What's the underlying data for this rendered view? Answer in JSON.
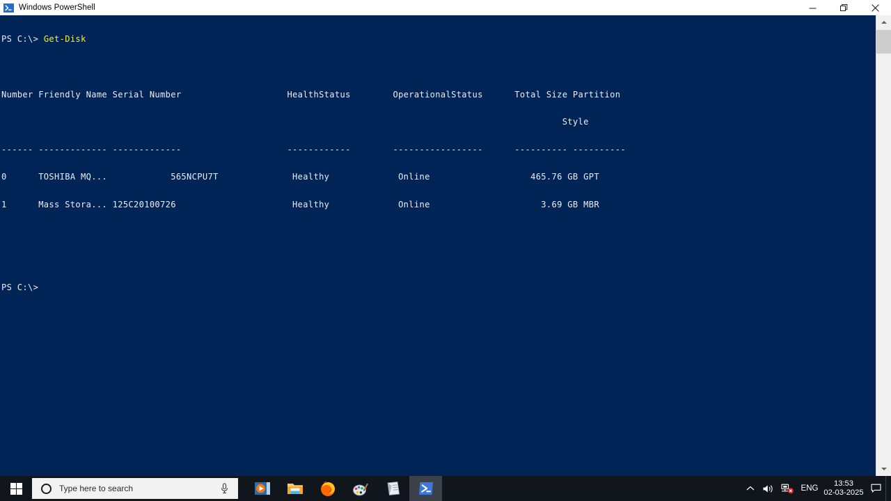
{
  "window": {
    "title": "Windows PowerShell",
    "icon": "powershell-icon",
    "controls": {
      "minimize": "minimize-button",
      "restore": "restore-button",
      "close": "close-button"
    }
  },
  "console": {
    "background_color": "#012456",
    "foreground_color": "#eeedf0",
    "accent_command_color": "#f3f32f",
    "prompt": "PS C:\\>",
    "command": "Get-Disk",
    "lines": [
      {
        "text": "Number Friendly Name Serial Number                    HealthStatus        OperationalStatus      Total Size Partition "
      },
      {
        "text": "                                                                                                          Style     "
      },
      {
        "text": "------ ------------- -------------                    ------------        -----------------      ---------- ----------"
      },
      {
        "text": "0      TOSHIBA MQ...            565NCPU7T              Healthy             Online                   465.76 GB GPT       "
      },
      {
        "text": "1      Mass Stora... 125C20100726                      Healthy             Online                     3.69 GB MBR       "
      }
    ],
    "trailing_prompt": "PS C:\\>"
  },
  "table": {
    "headers": [
      "Number",
      "Friendly Name",
      "Serial Number",
      "HealthStatus",
      "OperationalStatus",
      "Total Size",
      "Partition Style"
    ],
    "rows": [
      {
        "number": "0",
        "friendly_name": "TOSHIBA MQ...",
        "serial_number": "565NCPU7T",
        "health_status": "Healthy",
        "operational_status": "Online",
        "total_size": "465.76 GB",
        "partition_style": "GPT"
      },
      {
        "number": "1",
        "friendly_name": "Mass Stora...",
        "serial_number": "125C20100726",
        "health_status": "Healthy",
        "operational_status": "Online",
        "total_size": "3.69 GB",
        "partition_style": "MBR"
      }
    ]
  },
  "scrollbar": {
    "up_arrow": "scroll-up-arrow-icon",
    "down_arrow": "scroll-down-arrow-icon",
    "thumb": "scrollbar-thumb"
  },
  "taskbar": {
    "background_color": "#11161c",
    "start": "start-button",
    "search": {
      "placeholder": "Type here to search",
      "icon": "search-circle-icon",
      "mic": "microphone-icon"
    },
    "apps": [
      {
        "name": "media-player",
        "label": "Media Player",
        "running": false,
        "active": false
      },
      {
        "name": "file-explorer",
        "label": "File Explorer",
        "running": true,
        "active": false
      },
      {
        "name": "firefox",
        "label": "Firefox",
        "running": true,
        "active": false
      },
      {
        "name": "paint",
        "label": "Paint",
        "running": true,
        "active": false
      },
      {
        "name": "sticky-notes",
        "label": "Sticky Notes",
        "running": true,
        "active": false
      },
      {
        "name": "powershell",
        "label": "Windows PowerShell",
        "running": true,
        "active": true
      }
    ],
    "tray": {
      "chevron": "show-hidden-icons-chevron",
      "volume": "volume-icon",
      "network": "network-error-icon",
      "language": "ENG",
      "time": "13:53",
      "date": "02-03-2025",
      "action_center": "action-center-icon"
    }
  }
}
